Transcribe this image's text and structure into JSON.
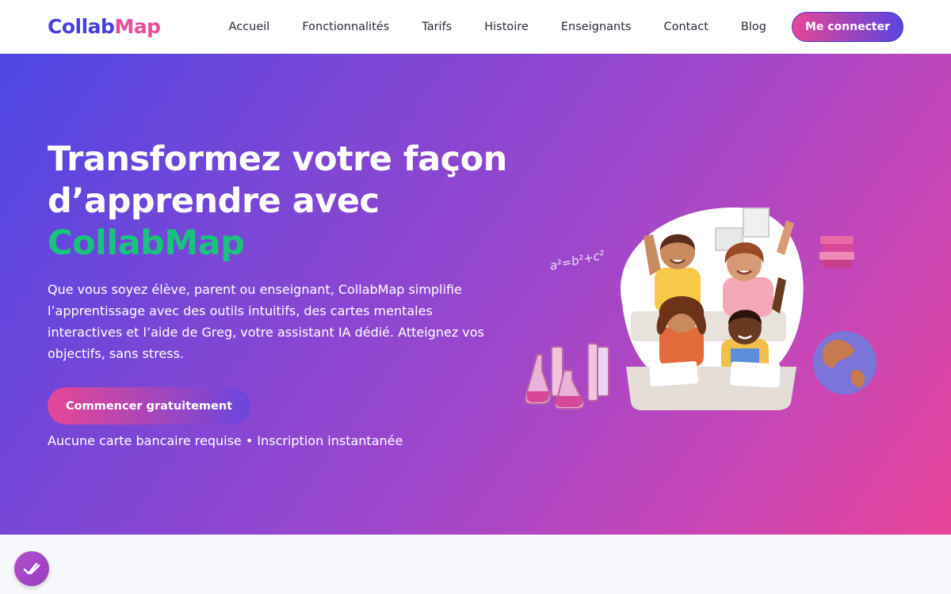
{
  "nav": {
    "logo_part1": "Collab",
    "logo_part2": "Map",
    "links": [
      "Accueil",
      "Fonctionnalités",
      "Tarifs",
      "Histoire",
      "Enseignants",
      "Contact",
      "Blog"
    ],
    "login_button": "Me connecter"
  },
  "hero": {
    "title_line1": "Transformez votre façon",
    "title_line2": "d’apprendre avec",
    "title_accent": "CollabMap",
    "description": "Que vous soyez élève, parent ou enseignant, CollabMap simplifie l’apprentissage avec des outils intuitifs, des cartes mentales interactives et l’aide de Greg, votre assistant IA dédié. Atteignez vos objectifs, sans stress.",
    "cta_button": "Commencer gratuitement",
    "note": "Aucune carte bancaire requise • Inscription instantanée",
    "formula": "a²=b²+c²"
  },
  "colors": {
    "brand_blue": "#4a3fdc",
    "brand_pink": "#e74d9b",
    "accent_green": "#18c47c"
  },
  "icons": [
    "students-illustration",
    "books-icon",
    "globe-icon",
    "lab-flasks-icon",
    "chat-widget-icon"
  ]
}
